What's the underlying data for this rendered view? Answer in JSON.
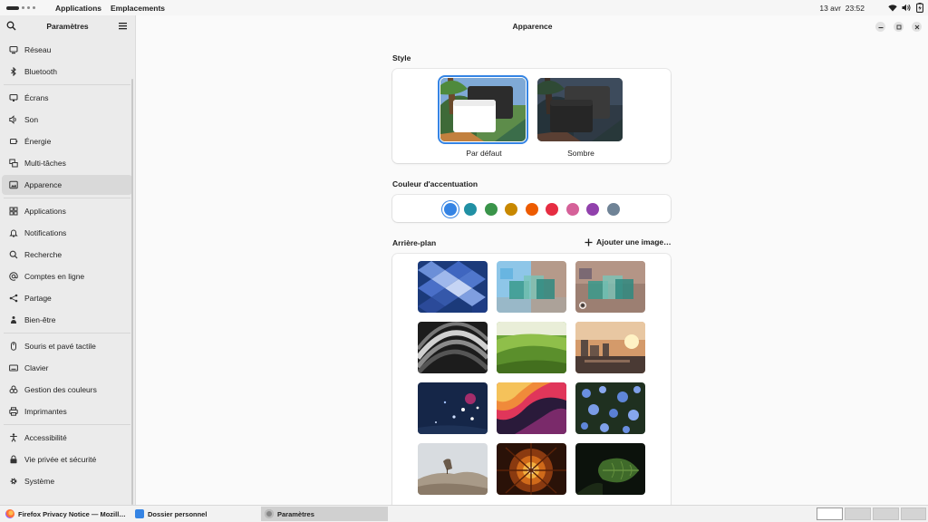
{
  "topbar": {
    "menu_applications": "Applications",
    "menu_places": "Emplacements",
    "date": "13 avr",
    "time": "23:52",
    "icons": [
      "wifi-icon",
      "volume-icon",
      "battery-icon"
    ]
  },
  "sidebar": {
    "title": "Paramètres",
    "items": [
      {
        "label": "Réseau",
        "icon": "network-icon"
      },
      {
        "label": "Bluetooth",
        "icon": "bluetooth-icon"
      },
      {
        "label": "Écrans",
        "icon": "display-icon"
      },
      {
        "label": "Son",
        "icon": "sound-icon"
      },
      {
        "label": "Énergie",
        "icon": "power-icon"
      },
      {
        "label": "Multi-tâches",
        "icon": "multitasking-icon"
      },
      {
        "label": "Apparence",
        "icon": "appearance-icon"
      },
      {
        "label": "Applications",
        "icon": "apps-icon"
      },
      {
        "label": "Notifications",
        "icon": "bell-icon"
      },
      {
        "label": "Recherche",
        "icon": "search-icon"
      },
      {
        "label": "Comptes en ligne",
        "icon": "at-icon"
      },
      {
        "label": "Partage",
        "icon": "share-icon"
      },
      {
        "label": "Bien-être",
        "icon": "wellbeing-icon"
      },
      {
        "label": "Souris et pavé tactile",
        "icon": "mouse-icon"
      },
      {
        "label": "Clavier",
        "icon": "keyboard-icon"
      },
      {
        "label": "Gestion des couleurs",
        "icon": "color-icon"
      },
      {
        "label": "Imprimantes",
        "icon": "printer-icon"
      },
      {
        "label": "Accessibilité",
        "icon": "accessibility-icon"
      },
      {
        "label": "Vie privée et sécurité",
        "icon": "privacy-icon"
      },
      {
        "label": "Système",
        "icon": "gear-icon"
      }
    ],
    "active_index": 6
  },
  "main": {
    "title": "Apparence",
    "style_section": "Style",
    "style_options": [
      {
        "label": "Par défaut",
        "selected": true
      },
      {
        "label": "Sombre",
        "selected": false
      }
    ],
    "accent_section": "Couleur d'accentuation",
    "accent_colors": [
      "#3584e4",
      "#2190a4",
      "#3a944a",
      "#c88800",
      "#ed5b00",
      "#e62d42",
      "#d56199",
      "#9141ac",
      "#6f8396"
    ],
    "accent_selected": 0,
    "background_section": "Arrière-plan",
    "add_image": "Ajouter une image…",
    "selected_wallpaper": 2
  },
  "taskbar": {
    "tasks": [
      {
        "label": "Firefox Privacy Notice — Mozill…",
        "active": false
      },
      {
        "label": "Dossier personnel",
        "active": false
      },
      {
        "label": "Paramètres",
        "active": true
      }
    ],
    "workspaces": 4,
    "active_workspace": 0
  }
}
